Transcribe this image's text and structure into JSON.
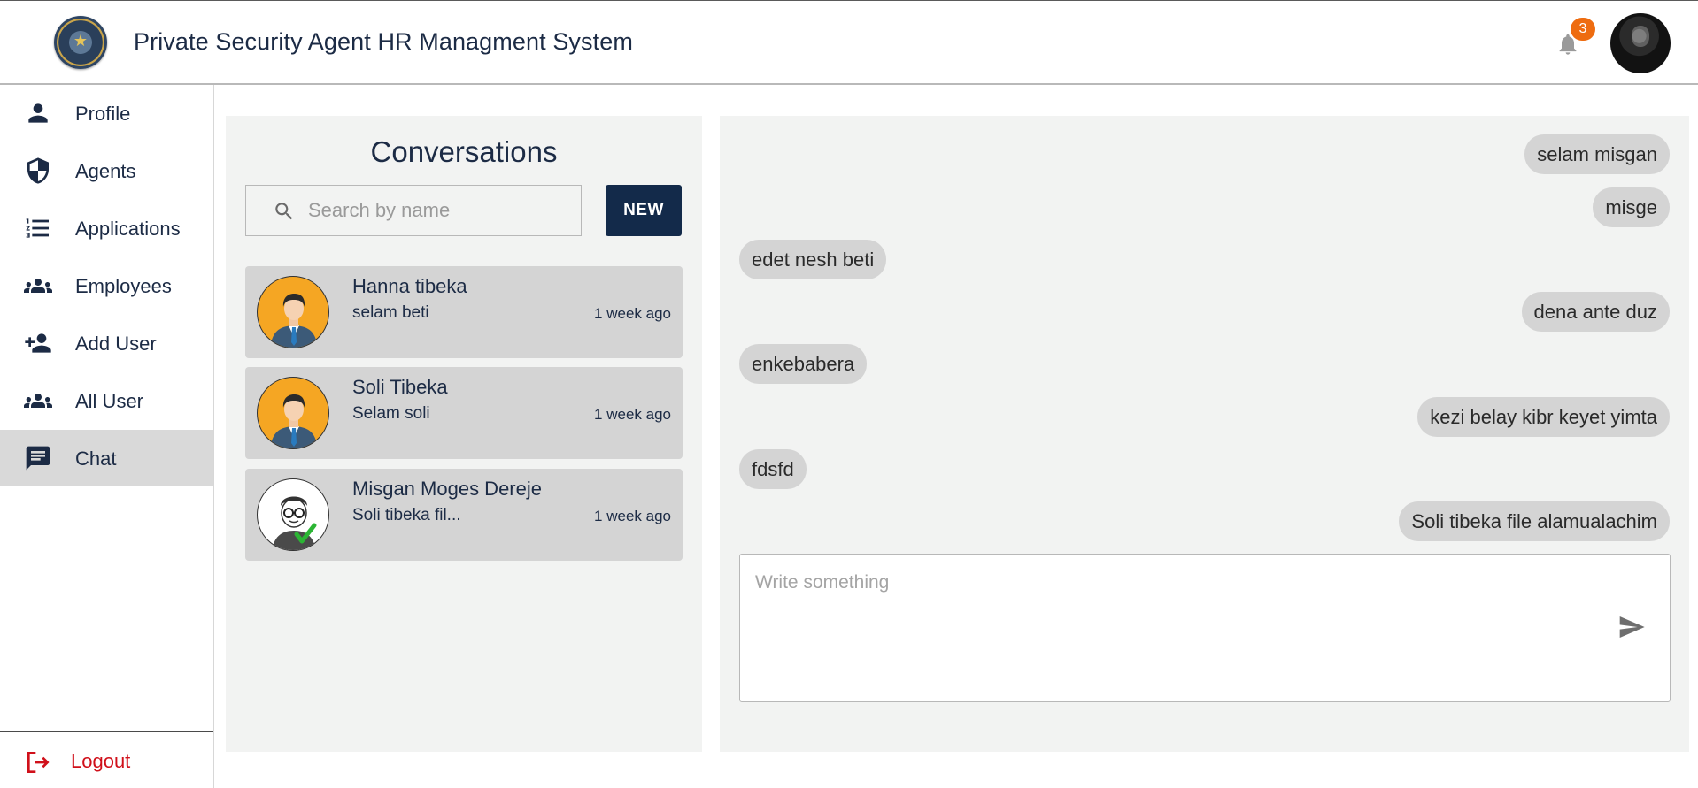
{
  "header": {
    "title": "Private Security Agent HR Managment System",
    "notification_count": "3"
  },
  "sidebar": {
    "items": [
      {
        "label": "Profile",
        "icon": "person-icon"
      },
      {
        "label": "Agents",
        "icon": "shield-icon"
      },
      {
        "label": "Applications",
        "icon": "list-icon"
      },
      {
        "label": "Employees",
        "icon": "group-icon"
      },
      {
        "label": "Add User",
        "icon": "person-add-icon"
      },
      {
        "label": "All User",
        "icon": "group-icon"
      },
      {
        "label": "Chat",
        "icon": "chat-icon",
        "active": true
      }
    ],
    "logout_label": "Logout"
  },
  "conversations": {
    "title": "Conversations",
    "search_placeholder": "Search by name",
    "new_button": "NEW",
    "items": [
      {
        "name": "Hanna tibeka",
        "last_message": "selam beti",
        "time": "1 week ago"
      },
      {
        "name": "Soli Tibeka",
        "last_message": "Selam soli",
        "time": "1 week ago"
      },
      {
        "name": "Misgan Moges Dereje",
        "last_message": "Soli tibeka fil...",
        "time": "1 week ago"
      }
    ]
  },
  "chat": {
    "messages": [
      {
        "text": "selam misgan",
        "direction": "out"
      },
      {
        "text": "misge",
        "direction": "out"
      },
      {
        "text": "edet nesh beti",
        "direction": "in"
      },
      {
        "text": "dena ante duz",
        "direction": "out"
      },
      {
        "text": "enkebabera",
        "direction": "in"
      },
      {
        "text": "kezi belay kibr keyet yimta",
        "direction": "out"
      },
      {
        "text": "fdsfd",
        "direction": "in"
      },
      {
        "text": "Soli tibeka file alamualachim",
        "direction": "out"
      }
    ],
    "composer_placeholder": "Write something"
  },
  "colors": {
    "primary": "#132a4a",
    "text": "#1c2b45",
    "badge": "#ee6c10",
    "logout": "#d0101a",
    "panel": "#f2f3f2",
    "bubble": "#d4d4d4"
  }
}
